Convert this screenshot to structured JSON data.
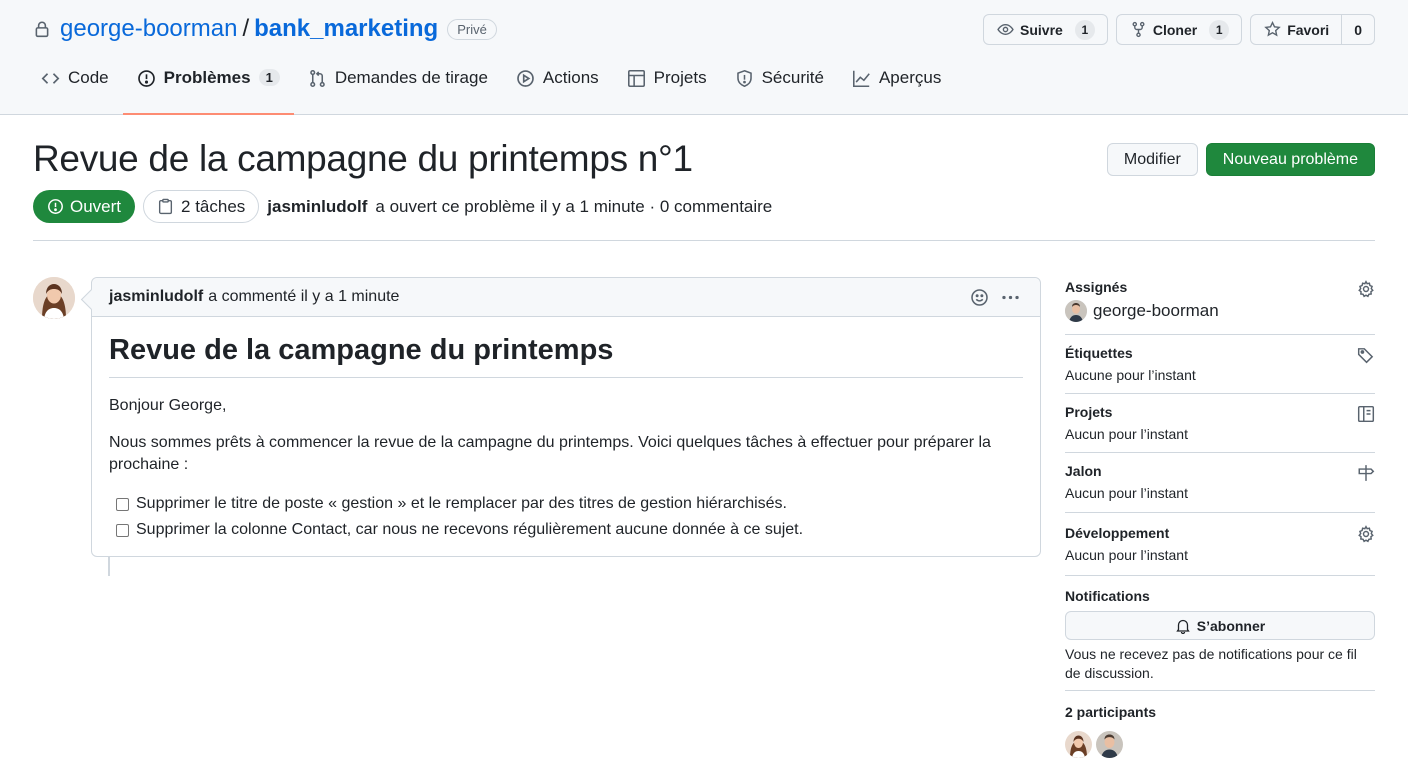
{
  "repo": {
    "owner": "george-boorman",
    "separator": "/",
    "name": "bank_marketing",
    "visibility": "Privé"
  },
  "repo_actions": {
    "watch_label": "Suivre",
    "watch_count": "1",
    "fork_label": "Cloner",
    "fork_count": "1",
    "star_label": "Favori",
    "star_count": "0"
  },
  "tabs": {
    "code": "Code",
    "issues": "Problèmes",
    "issues_count": "1",
    "pulls": "Demandes de tirage",
    "actions": "Actions",
    "projects": "Projets",
    "security": "Sécurité",
    "insights": "Aperçus"
  },
  "issue": {
    "title": "Revue de la campagne du printemps n°1",
    "edit_label": "Modifier",
    "new_issue_label": "Nouveau problème",
    "state": "Ouvert",
    "tasks": "2 tâches",
    "author": "jasminludolf",
    "meta_text": "a ouvert ce problème il y a 1 minute · 0 commentaire"
  },
  "comment": {
    "author": "jasminludolf",
    "header_text": "a commenté il y a 1 minute",
    "heading": "Revue de la campagne du printemps",
    "greeting": "Bonjour George,",
    "paragraph": "Nous sommes prêts à commencer la revue de la campagne du printemps. Voici quelques tâches à effectuer pour préparer la prochaine :",
    "tasks": [
      {
        "text": "Supprimer le titre de poste « gestion » et le remplacer par des titres de gestion hiérarchisés.",
        "checked": false
      },
      {
        "text": "Supprimer la colonne Contact, car nous ne recevons régulièrement aucune donnée à ce sujet.",
        "checked": false
      }
    ]
  },
  "sidebar": {
    "assignees_title": "Assignés",
    "assignee": "george-boorman",
    "labels_title": "Étiquettes",
    "labels_value": "Aucune pour l’instant",
    "projects_title": "Projets",
    "projects_value": "Aucun pour l’instant",
    "milestone_title": "Jalon",
    "milestone_value": "Aucun pour l’instant",
    "development_title": "Développement",
    "development_value": "Aucun pour l’instant",
    "notifications_title": "Notifications",
    "subscribe_label": "S’abonner",
    "notifications_note": "Vous ne recevez pas de notifications pour ce fil de discussion.",
    "participants_title": "2 participants"
  },
  "colors": {
    "accent": "#0969da",
    "open_green": "#1f883d",
    "tab_underline": "#fd8c73",
    "border": "#d0d7de"
  },
  "icons": [
    "lock-icon",
    "eye-icon",
    "fork-icon",
    "star-icon",
    "code-icon",
    "issue-icon",
    "pull-request-icon",
    "play-icon",
    "table-icon",
    "shield-icon",
    "graph-icon",
    "issue-open-icon",
    "tasklist-icon",
    "smiley-icon",
    "kebab-icon",
    "gear-icon",
    "tag-icon",
    "project-icon",
    "milestone-icon",
    "bell-icon"
  ]
}
